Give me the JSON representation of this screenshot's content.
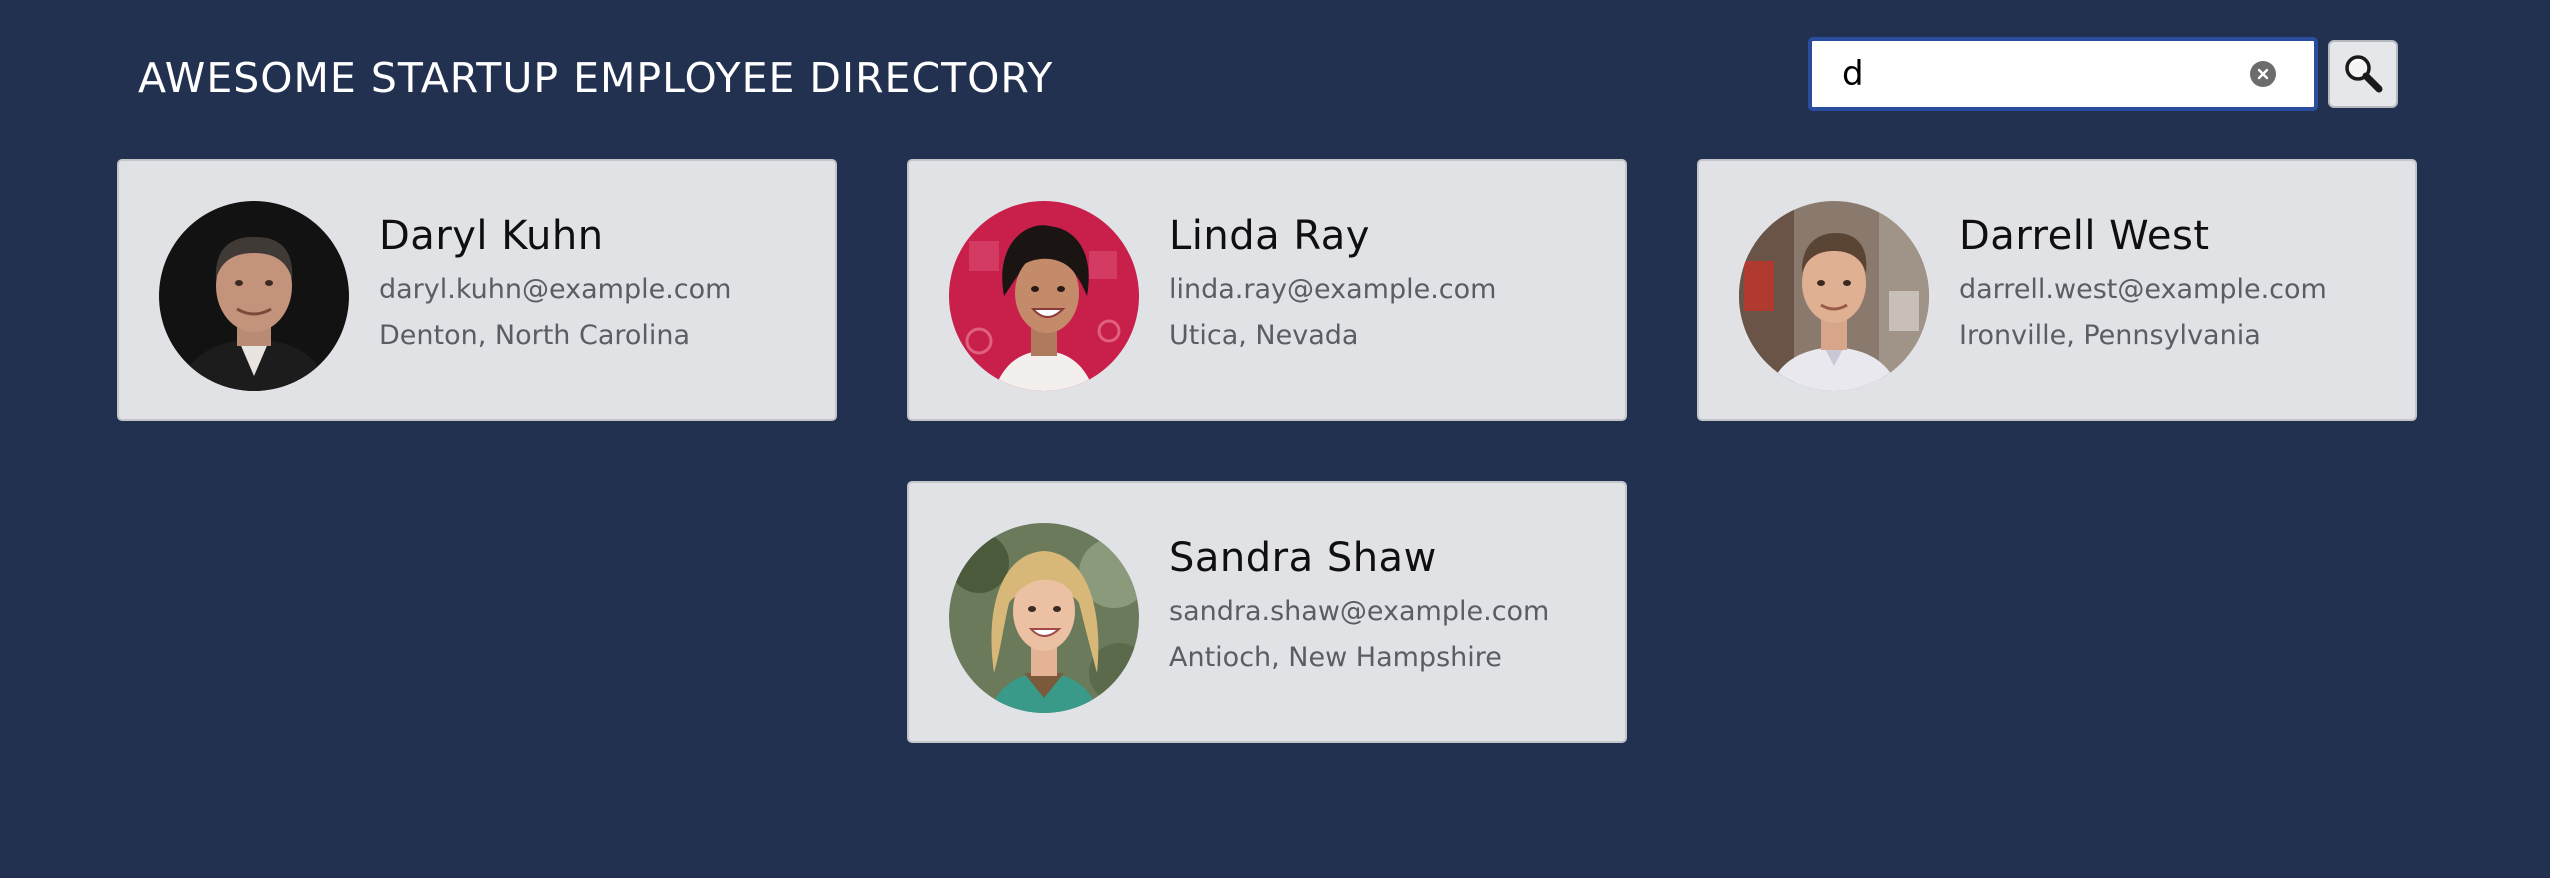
{
  "header": {
    "title": "AWESOME STARTUP EMPLOYEE DIRECTORY"
  },
  "search": {
    "value": "d",
    "clear_icon": "close-circle-icon",
    "button_icon": "magnifier-icon"
  },
  "employees": [
    {
      "name": "Daryl Kuhn",
      "email": "daryl.kuhn@example.com",
      "location": "Denton, North Carolina"
    },
    {
      "name": "Linda Ray",
      "email": "linda.ray@example.com",
      "location": "Utica, Nevada"
    },
    {
      "name": "Darrell West",
      "email": "darrell.west@example.com",
      "location": "Ironville, Pennsylvania"
    },
    {
      "name": "Sandra Shaw",
      "email": "sandra.shaw@example.com",
      "location": "Antioch, New Hampshire"
    }
  ],
  "colors": {
    "background": "#233150",
    "card": "#e1e2e6",
    "search_border": "#2a4d9e"
  }
}
